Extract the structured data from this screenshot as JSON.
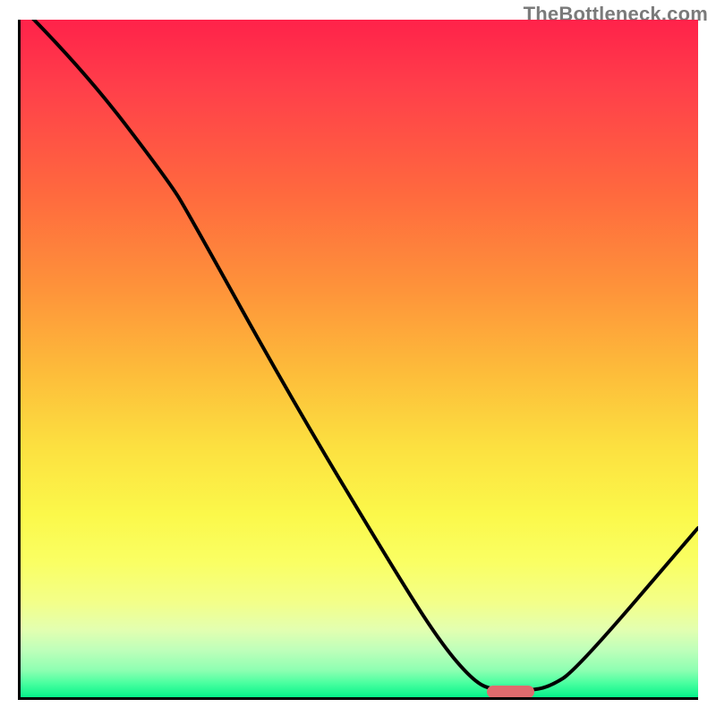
{
  "attribution": "TheBottleneck.com",
  "chart_data": {
    "type": "line",
    "title": "",
    "xlabel": "",
    "ylabel": "",
    "xlim": [
      0,
      100
    ],
    "ylim": [
      0,
      100
    ],
    "curve_points": [
      {
        "x": 0,
        "y": 102
      },
      {
        "x": 9,
        "y": 93
      },
      {
        "x": 22,
        "y": 76
      },
      {
        "x": 25,
        "y": 71
      },
      {
        "x": 40,
        "y": 44
      },
      {
        "x": 55,
        "y": 19
      },
      {
        "x": 62,
        "y": 8
      },
      {
        "x": 67,
        "y": 2.2
      },
      {
        "x": 70,
        "y": 1.0
      },
      {
        "x": 75,
        "y": 1.0
      },
      {
        "x": 78,
        "y": 1.5
      },
      {
        "x": 82,
        "y": 4
      },
      {
        "x": 100,
        "y": 25
      }
    ],
    "gradient_stops": [
      {
        "pos": 0.0,
        "color": "#ff224a"
      },
      {
        "pos": 0.4,
        "color": "#fe943a"
      },
      {
        "pos": 0.73,
        "color": "#fbf84a"
      },
      {
        "pos": 1.0,
        "color": "#06f18a"
      }
    ],
    "marker": {
      "x": 72,
      "y": 1.2,
      "width": 7,
      "height": 1.8,
      "color": "#df6b6e"
    }
  }
}
